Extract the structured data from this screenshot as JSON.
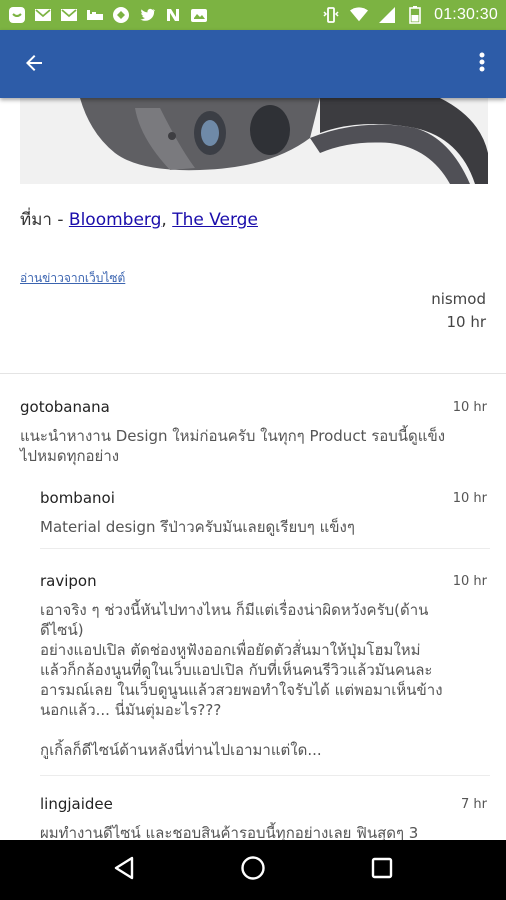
{
  "status_bar": {
    "time": "01:30:30",
    "background": "#7cb342",
    "left_icons": [
      "message-icon",
      "mail-icon",
      "mail-icon",
      "sleep-icon",
      "app-icon",
      "twitter-icon",
      "n-icon",
      "image-icon"
    ],
    "right_icons": [
      "vibrate-icon",
      "wifi-icon",
      "signal-icon",
      "battery-icon"
    ]
  },
  "app_bar": {
    "background": "#2d5ca8",
    "back_icon": "arrow-left-icon",
    "menu_icon": "more-vert-icon"
  },
  "article": {
    "source_prefix": "ที่มา - ",
    "sources": [
      "Bloomberg",
      "The Verge"
    ],
    "source_separator": ", ",
    "read_more": "อ่านข่าวจากเว็บไซต์",
    "author": "nismod",
    "time": "10 hr"
  },
  "comments": [
    {
      "user": "gotobanana",
      "time": "10 hr",
      "body": "แนะนำหางาน Design ใหม่ก่อนครับ ในทุกๆ Product รอบนี้ดูแข็ง\nไปหมดทุกอย่าง"
    },
    {
      "user": "bombanoi",
      "time": "10 hr",
      "body": "Material design รึป่าวครับมันเลยดูเรียบๆ แข็งๆ"
    },
    {
      "user": "ravipon",
      "time": "10 hr",
      "body": "เอาจริง ๆ ช่วงนี้หันไปทางไหน ก็มีแต่เรื่องน่าผิดหวังครับ(ด้าน\nดีไซน์)\nอย่างแอปเปิล ตัดช่องหูฟังออกเพื่อยัดตัวสั่นมาให้ปุ่มโฮมใหม่\nแล้วก็กล้องนูนที่ดูในเว็บแอปเปิล กับที่เห็นคนรีวิวแล้วมันคนละ\nอารมณ์เลย ในเว็บดูนูนแล้วสวยพอทำใจรับได้ แต่พอมาเห็นข้าง\nนอกแล้ว... นี่มันตุ่มอะไร???\n\nกูเกิ้ลก็ดีไซน์ด้านหลังนี่ท่านไปเอามาแต่ใด..."
    },
    {
      "user": "lingjaidee",
      "time": "7 hr",
      "body": "ผมทำงานดีไซน์ และชอบสินค้ารอบนี้ทุกอย่างเลย ฟินสุดๆ 3"
    }
  ],
  "nav_bar": {
    "buttons": [
      "back-triangle-icon",
      "home-circle-icon",
      "recents-square-icon"
    ]
  }
}
